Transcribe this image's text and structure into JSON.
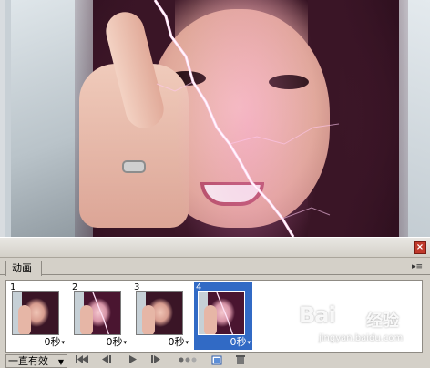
{
  "panel": {
    "close_label": "×",
    "tab_label": "动画",
    "menu_label": "▸≡"
  },
  "frames": [
    {
      "index": "1",
      "delay": "0秒",
      "selected": false,
      "effect": "none"
    },
    {
      "index": "2",
      "delay": "0秒",
      "selected": false,
      "effect": "lightning"
    },
    {
      "index": "3",
      "delay": "0秒",
      "selected": false,
      "effect": "none"
    },
    {
      "index": "4",
      "delay": "0秒",
      "selected": true,
      "effect": "lightning"
    }
  ],
  "controls": {
    "loop_label": "一直有效",
    "loop_caret": "▼",
    "first_frame_icon": "first-frame-icon",
    "prev_frame_icon": "previous-frame-icon",
    "play_icon": "play-icon",
    "next_frame_icon": "next-frame-icon",
    "tween_icon": "tween-icon",
    "new_frame_icon": "duplicate-frame-icon",
    "delete_frame_icon": "trash-icon"
  },
  "watermark": {
    "brand": "Bai",
    "cn": "经验",
    "url": "jingyan.baidu.com"
  },
  "colors": {
    "selection": "#316ac5",
    "panel_bg": "#d4d0c8",
    "close_red": "#c0392b",
    "lightning": "#ffd8f4"
  }
}
